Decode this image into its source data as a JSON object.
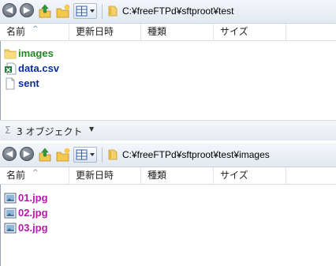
{
  "pane1": {
    "path": "C:¥freeFTPd¥sftproot¥test",
    "columns": [
      "名前",
      "更新日時",
      "種類",
      "サイズ"
    ],
    "files": [
      {
        "name": "images",
        "icon": "folder-icon",
        "color": "#1f8a1f"
      },
      {
        "name": "data.csv",
        "icon": "excel-csv-icon",
        "color": "#0d2aa0"
      },
      {
        "name": "sent",
        "icon": "file-icon",
        "color": "#0d2aa0"
      }
    ]
  },
  "status": {
    "sigma": "Σ",
    "text": "3 オブジェクト",
    "caret": "▼"
  },
  "pane2": {
    "path": "C:¥freeFTPd¥sftproot¥test¥images",
    "columns": [
      "名前",
      "更新日時",
      "種類",
      "サイズ"
    ],
    "files": [
      {
        "name": "01.jpg",
        "icon": "image-file-icon",
        "color": "#b21aa8"
      },
      {
        "name": "02.jpg",
        "icon": "image-file-icon",
        "color": "#b21aa8"
      },
      {
        "name": "03.jpg",
        "icon": "image-file-icon",
        "color": "#b21aa8"
      }
    ]
  },
  "toolbar": {
    "back_glyph": "◀",
    "forward_glyph": "▶",
    "sort_glyph": "^"
  }
}
